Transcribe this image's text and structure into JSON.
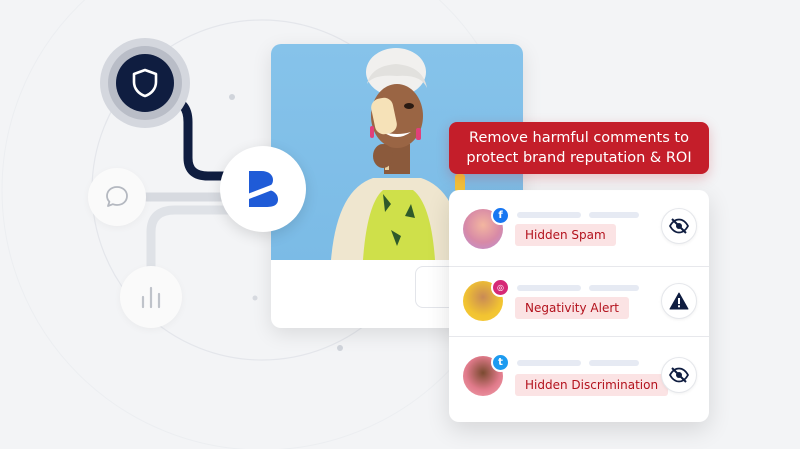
{
  "banner": {
    "text": "Remove harmful comments to protect brand reputation & ROI"
  },
  "colors": {
    "navy": "#0f1d40",
    "brand_blue": "#1f5bd7",
    "banner_red": "#c41e2a",
    "tag_bg": "#fbe3e4",
    "tag_text": "#b3121d",
    "photo_bg": "#86c3ea"
  },
  "nodes": {
    "shield_icon": "shield-icon",
    "brand_icon": "brand-logo-icon",
    "chat_icon": "chat-bubble-icon",
    "chart_icon": "bar-chart-icon"
  },
  "comments": [
    {
      "platform": "facebook",
      "badge": "f",
      "tag": "Hidden Spam",
      "action_icon": "eye-off-icon"
    },
    {
      "platform": "instagram",
      "badge": "◎",
      "tag": "Negativity Alert",
      "action_icon": "warning-icon"
    },
    {
      "platform": "twitter",
      "badge": "t",
      "tag": "Hidden Discrimination",
      "action_icon": "eye-off-icon"
    }
  ]
}
